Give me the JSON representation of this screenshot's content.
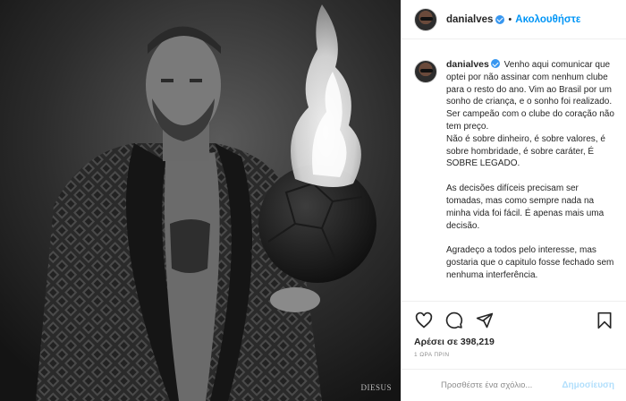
{
  "post": {
    "username": "danialves",
    "follow_label": "Ακολουθήστε",
    "dot": "•",
    "photo_credit": "DIESUS"
  },
  "caption": {
    "username": "danialves",
    "paragraphs": [
      "Venho aqui comunicar que optei por não assinar com nenhum clube para o resto do ano. Vim ao Brasil por um sonho de criança, e o sonho foi realizado. Ser campeão com o clube do coração não tem preço.",
      "Não é sobre dinheiro, é sobre valores, é sobre hombridade, é sobre caráter, É SOBRE LEGADO.",
      "As decisões difíceis precisam ser tomadas, mas como sempre nada na minha vida foi fácil. É apenas mais uma decisão.",
      "Agradeço a todos pelo interesse, mas gostaria que o capitulo fosse fechado sem nenhuma interferência."
    ]
  },
  "actions": {
    "icons": [
      "heart-icon",
      "comment-icon",
      "share-icon",
      "bookmark-icon"
    ],
    "likes_text": "Αρέσει σε 398,219",
    "time_text": "1 ΩΡΑ ΠΡΙΝ"
  },
  "comment_box": {
    "placeholder": "Προσθέστε ένα σχόλιο...",
    "post_label": "Δημοσίευση"
  }
}
